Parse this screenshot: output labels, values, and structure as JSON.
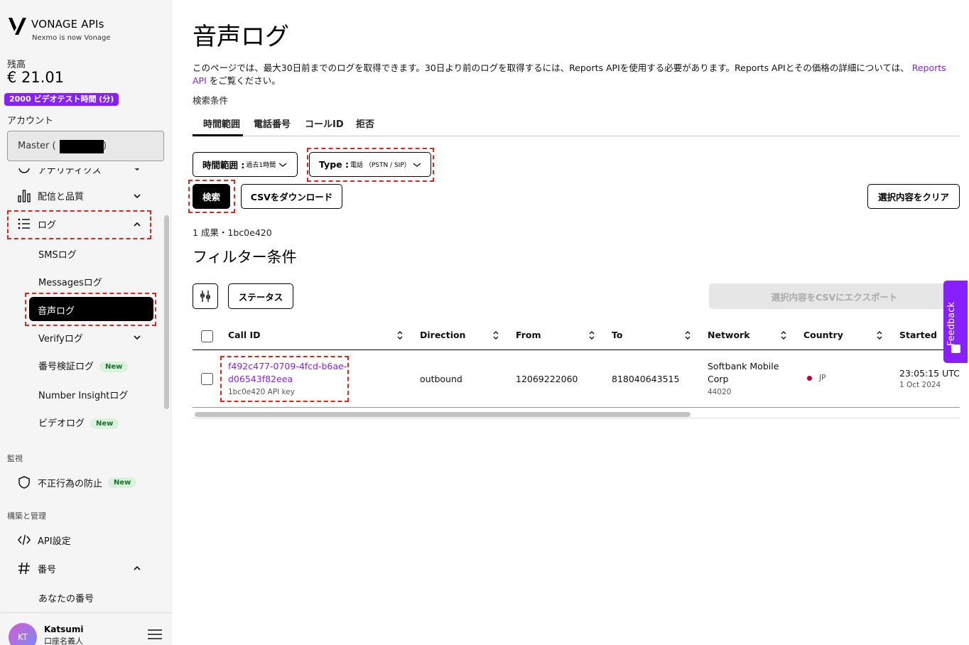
{
  "brand": {
    "name": "VONAGE APIs",
    "sub": "Nexmo is now Vonage"
  },
  "balance": {
    "label": "残高",
    "value": "€ 21.01",
    "video_badge": "2000 ビデオテスト時間 (分)"
  },
  "account": {
    "label": "アカウント",
    "value": "Master ("
  },
  "nav": {
    "partial_item": "アナリティクス",
    "delivery": "配信と品質",
    "logs": "ログ",
    "sub": {
      "sms": "SMSログ",
      "messages": "Messagesログ",
      "voice": "音声ログ",
      "verify": "Verifyログ",
      "number_verify": "番号検証ログ",
      "number_insight": "Number Insightログ",
      "video": "ビデオログ"
    },
    "new_badge": "New",
    "section_monitor": "監視",
    "fraud": "不正行為の防止",
    "section_build": "構築と管理",
    "api_settings": "API設定",
    "numbers": "番号",
    "your_numbers": "あなたの番号"
  },
  "user": {
    "initials": "KT",
    "name": "Katsumi",
    "role": "口座名義人"
  },
  "page": {
    "title": "音声ログ",
    "intro_text": "このページでは、最大30日前までのログを取得できます。30日より前のログを取得するには、Reports APIを使用する必要があります。Reports APIとその価格の詳細については、",
    "intro_link": "Reports API",
    "intro_tail": "をご覧ください。",
    "search_label": "検索条件"
  },
  "tabs": [
    "時間範囲",
    "電話番号",
    "コールID",
    "拒否"
  ],
  "filters": {
    "time_label": "時間範囲 :",
    "time_value": "過去1時間",
    "type_label": "Type :",
    "type_value": "電話 （PSTN / SIP）",
    "search_btn": "検索",
    "csv_btn": "CSVをダウンロード",
    "clear_btn": "選択内容をクリア"
  },
  "results": {
    "count": "1 成果・1bc0e420",
    "filter_title": "フィルター条件",
    "status_btn": "ステータス",
    "export_btn": "選択内容をCSVにエクスポート"
  },
  "table": {
    "headers": [
      "Call ID",
      "Direction",
      "From",
      "To",
      "Network",
      "Country",
      "Started"
    ],
    "row": {
      "call_id_1": "f492c477-0709-4fcd-b6ae-",
      "call_id_2": "d06543f82eea",
      "api_key": "1bc0e420 API key",
      "direction": "outbound",
      "from": "12069222060",
      "to": "818040643515",
      "network_1": "Softbank Mobile",
      "network_2": "Corp",
      "network_code": "44020",
      "country": "JP",
      "started": "23:05:15 UTC",
      "started_date": "1 Oct 2024"
    }
  },
  "feedback": "Feedback",
  "colors": {
    "accent": "#871fff",
    "highlight": "#e1251b",
    "new_badge_bg": "#d9f2dc"
  }
}
